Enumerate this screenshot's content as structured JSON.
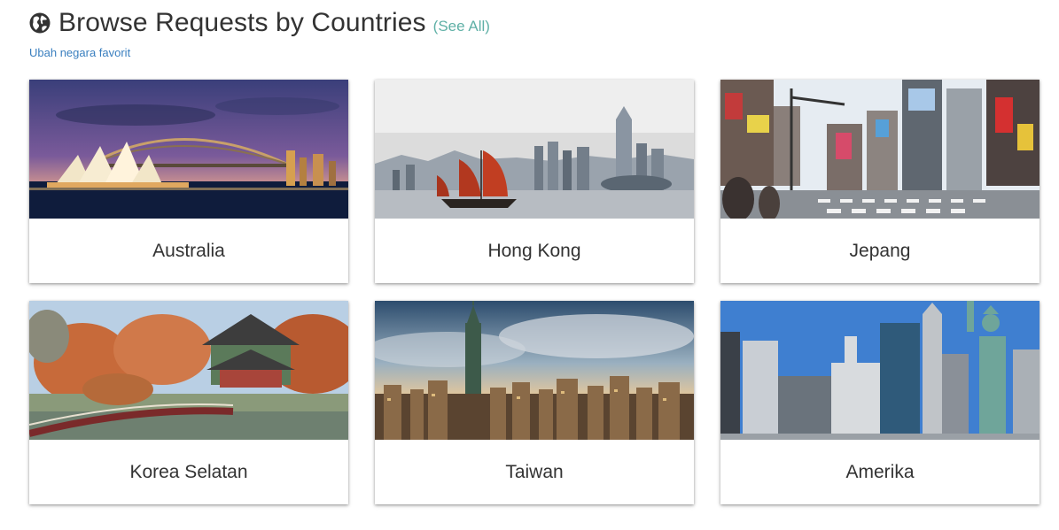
{
  "header": {
    "icon": "globe-icon",
    "title": "Browse Requests by Countries",
    "see_all": "(See All)",
    "change_favorite": "Ubah negara favorit"
  },
  "countries": [
    {
      "name": "Australia",
      "image": "sydney-opera-house-photo"
    },
    {
      "name": "Hong Kong",
      "image": "hong-kong-junk-boat-photo"
    },
    {
      "name": "Jepang",
      "image": "tokyo-shibuya-crossing-photo"
    },
    {
      "name": "Korea Selatan",
      "image": "korean-palace-pavilion-photo"
    },
    {
      "name": "Taiwan",
      "image": "taipei-101-skyline-photo"
    },
    {
      "name": "Amerika",
      "image": "new-york-statue-of-liberty-photo"
    }
  ],
  "colors": {
    "accent": "#5fb0a6",
    "link": "#3a7fbf",
    "text": "#333333"
  }
}
